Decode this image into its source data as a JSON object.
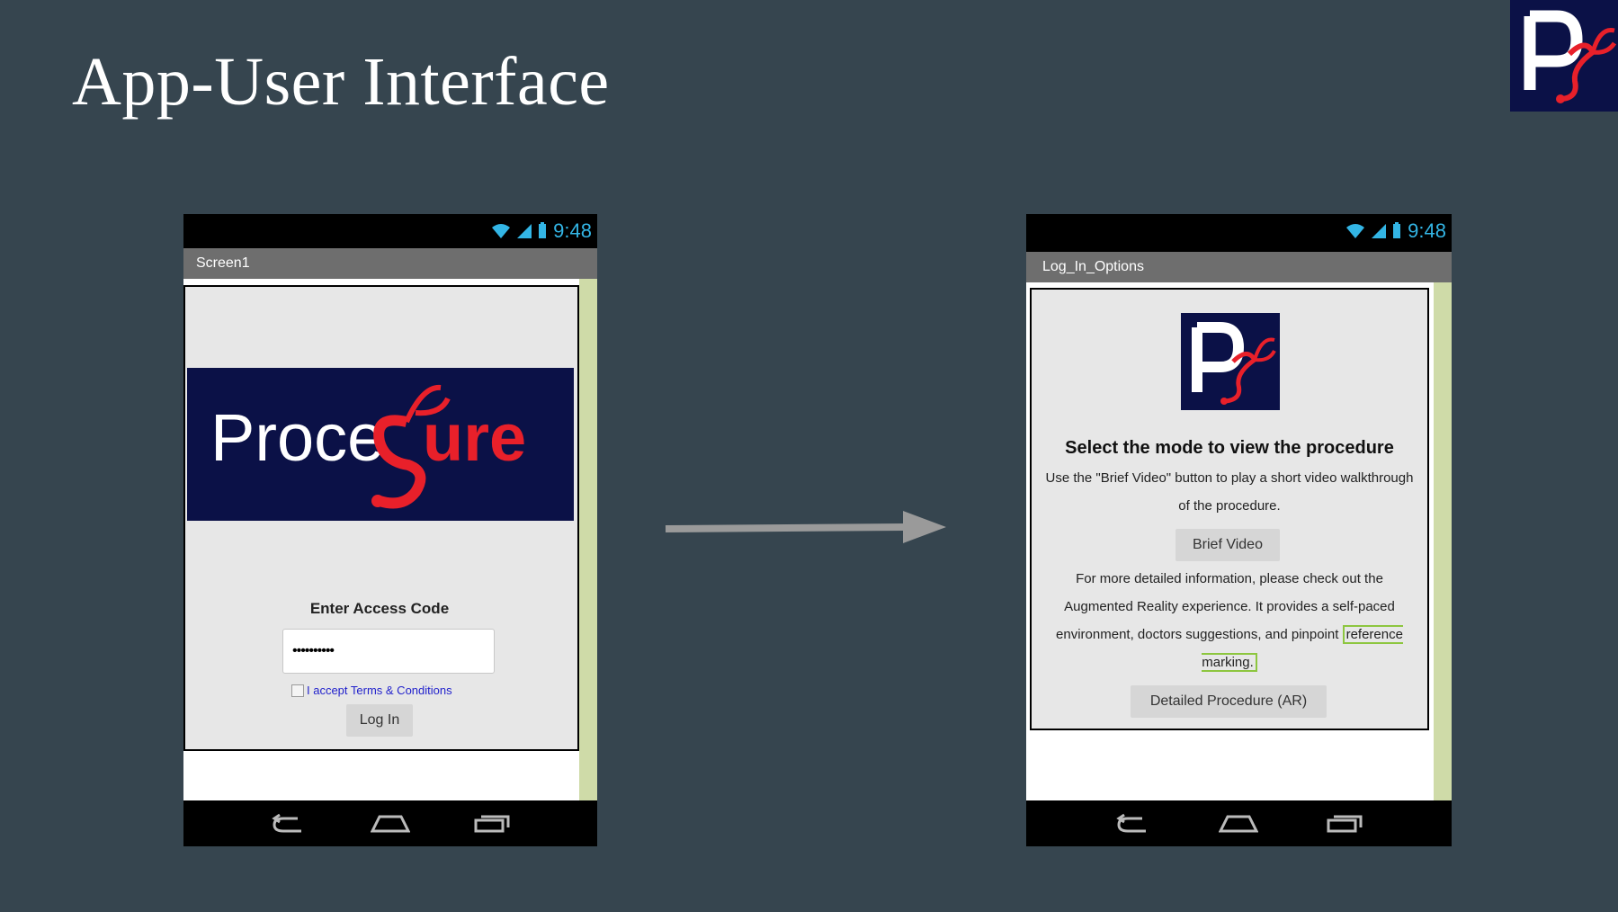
{
  "slide": {
    "title": "App-User Interface"
  },
  "phone_left": {
    "status_time": "9:48",
    "screen_title": "Screen1",
    "banner_text_white": "Proce",
    "banner_text_red": "ure",
    "access_label": "Enter Access Code",
    "access_code_value": "••••••••••",
    "terms_label": "I accept Terms & Conditions",
    "login_label": "Log In"
  },
  "phone_right": {
    "status_time": "9:48",
    "screen_title": "Log_In_Options",
    "heading": "Select the mode to view the procedure",
    "brief_text": "Use the \"Brief Video\" button to play a short video walkthrough of the procedure.",
    "brief_button": "Brief Video",
    "detail_text": "For more detailed information, please check out the Augmented Reality experience. It provides a self-paced environment, doctors suggestions, and pinpoint",
    "detail_highlight": "reference marking.",
    "detail_button": "Detailed Procedure (AR)"
  },
  "colors": {
    "background": "#36454f",
    "logo_navy": "#0b1147",
    "logo_red": "#e8202a",
    "status_blue": "#33b5e5",
    "highlight_green": "#8dc63f"
  },
  "icons": [
    "wifi-icon",
    "signal-icon",
    "battery-icon",
    "back-icon",
    "home-icon",
    "recents-icon",
    "arrow-right-icon",
    "stethoscope-logo"
  ]
}
